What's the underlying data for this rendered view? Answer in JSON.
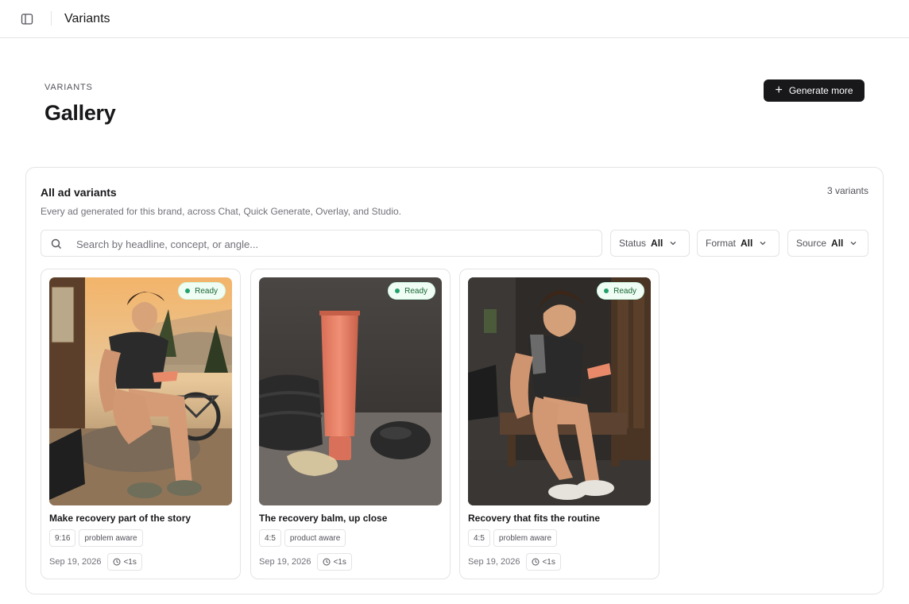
{
  "topbar": {
    "title": "Variants"
  },
  "header": {
    "eyebrow": "VARIANTS",
    "title": "Gallery",
    "generate_label": "Generate more"
  },
  "panel": {
    "title": "All ad variants",
    "subtitle": "Every ad generated for this brand, across Chat, Quick Generate, Overlay, and Studio.",
    "count": "3 variants"
  },
  "search": {
    "placeholder": "Search by headline, concept, or angle..."
  },
  "filters": [
    {
      "label": "Status",
      "value": "All"
    },
    {
      "label": "Format",
      "value": "All"
    },
    {
      "label": "Source",
      "value": "All"
    }
  ],
  "cards": [
    {
      "status": "Ready",
      "title": "Make recovery part of the story",
      "ratio": "9:16",
      "angle": "problem aware",
      "date": "Sep 19, 2026",
      "duration": "<1s"
    },
    {
      "status": "Ready",
      "title": "The recovery balm, up close",
      "ratio": "4:5",
      "angle": "product aware",
      "date": "Sep 19, 2026",
      "duration": "<1s"
    },
    {
      "status": "Ready",
      "title": "Recovery that fits the routine",
      "ratio": "4:5",
      "angle": "problem aware",
      "date": "Sep 19, 2026",
      "duration": "<1s"
    }
  ],
  "colors": {
    "accent": "#18181b",
    "ready_dot": "#22a06b",
    "ready_bg": "#f0fdf4",
    "border": "#e4e4e7"
  }
}
